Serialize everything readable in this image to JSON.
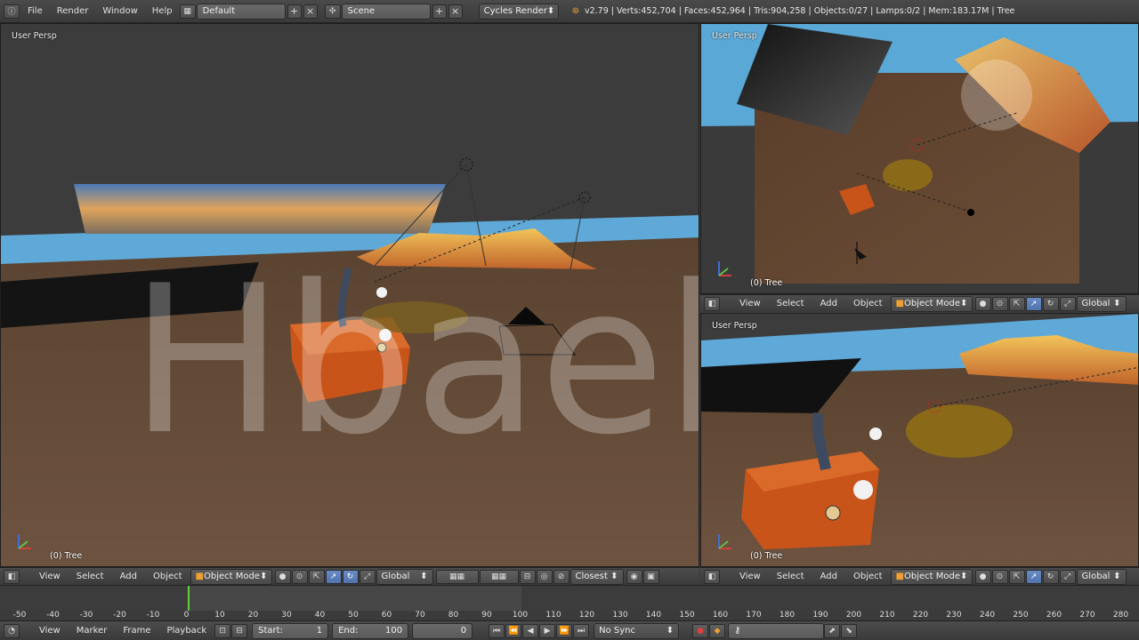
{
  "topbar": {
    "menu": [
      "File",
      "Render",
      "Window",
      "Help"
    ],
    "layout_name": "Default",
    "scene_name": "Scene",
    "render_engine": "Cycles Render",
    "stats": "v2.79 | Verts:452,704 | Faces:452,964 | Tris:904,258 | Objects:0/27 | Lamps:0/2 | Mem:183.17M | Tree"
  },
  "viewports": {
    "main": {
      "label": "User Persp",
      "object": "(0) Tree"
    },
    "top_right": {
      "label": "User Persp",
      "object": "(0) Tree"
    },
    "bottom_right": {
      "label": "User Persp",
      "object": "(0) Tree"
    }
  },
  "header": {
    "view": "View",
    "select": "Select",
    "add": "Add",
    "object": "Object",
    "mode": "Object Mode",
    "orientation": "Global",
    "snap": "Closest"
  },
  "timeline": {
    "ticks": [
      "-50",
      "-40",
      "-30",
      "-20",
      "-10",
      "0",
      "10",
      "20",
      "30",
      "40",
      "50",
      "60",
      "70",
      "80",
      "90",
      "100",
      "110",
      "120",
      "130",
      "140",
      "150",
      "160",
      "170",
      "180",
      "190",
      "200",
      "210",
      "220",
      "230",
      "240",
      "250",
      "260",
      "270",
      "280"
    ],
    "current_frame": 0
  },
  "bottombar": {
    "view": "View",
    "marker": "Marker",
    "frame": "Frame",
    "playback": "Playback",
    "start_label": "Start:",
    "start_value": "1",
    "end_label": "End:",
    "end_value": "100",
    "current": "0",
    "sync": "No Sync"
  },
  "watermark": "Hbaek",
  "colors": {
    "accent": "#5680c2",
    "playhead": "#5fcf3a",
    "box": "#c9541a"
  }
}
